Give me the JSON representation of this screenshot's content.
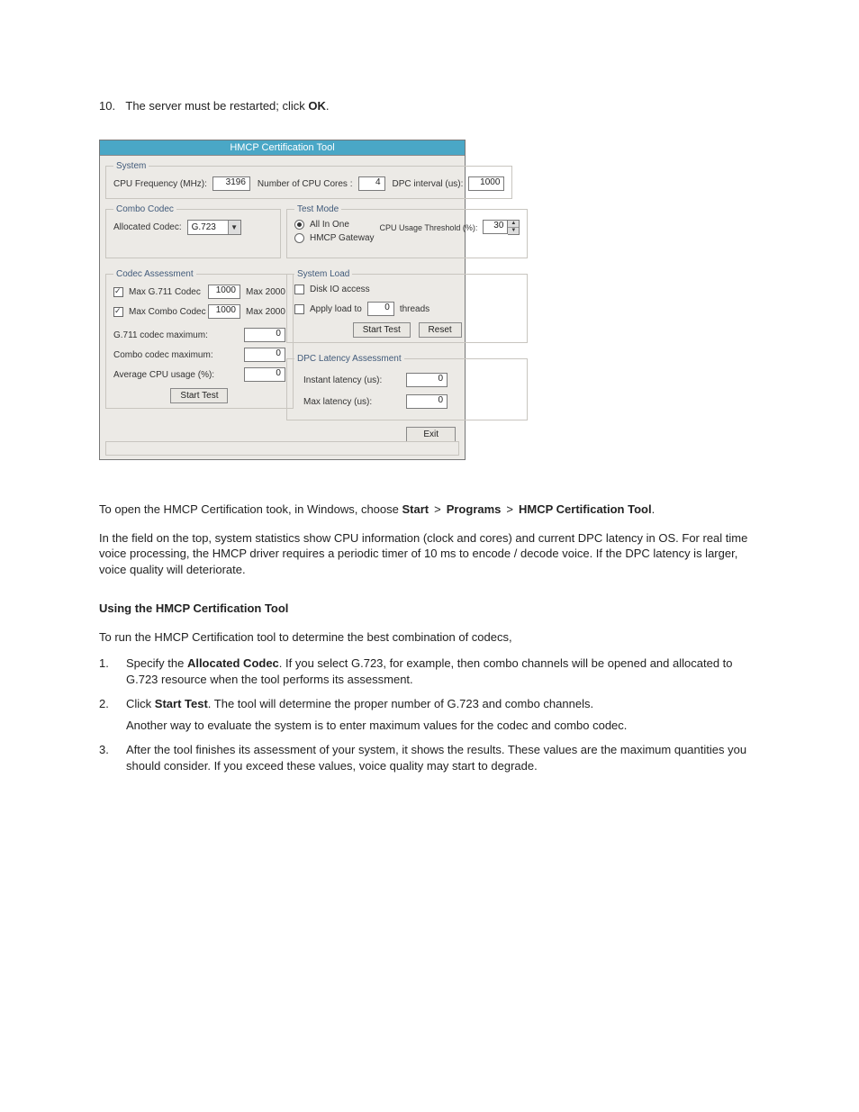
{
  "step10": {
    "num": "10.",
    "pre": "The server must be restarted; click ",
    "bold": "OK",
    "post": "."
  },
  "win": {
    "title": "HMCP Certification Tool",
    "system": {
      "legend": "System",
      "cpu_freq_label": "CPU Frequency (MHz):",
      "cpu_freq_value": "3196",
      "cores_label": "Number of CPU Cores :",
      "cores_value": "4",
      "dpc_label": "DPC interval (us):",
      "dpc_value": "1000"
    },
    "combo_codec": {
      "legend": "Combo Codec",
      "alloc_label": "Allocated Codec:",
      "alloc_value": "G.723"
    },
    "test_mode": {
      "legend": "Test Mode",
      "opt1": "All In One",
      "opt2": "HMCP Gateway",
      "thresh_label": "CPU Usage Threshold (%):",
      "thresh_value": "30"
    },
    "codec_assess": {
      "legend": "Codec Assessment",
      "g711_label": "Max G.711 Codec",
      "g711_value": "1000",
      "g711_max": "Max 2000",
      "combo_label": "Max Combo Codec",
      "combo_value": "1000",
      "combo_max": "Max 2000",
      "g711_max_label": "G.711 codec maximum:",
      "g711_max_value": "0",
      "combo_max_label": "Combo codec maximum:",
      "combo_max_value": "0",
      "avg_cpu_label": "Average CPU usage (%):",
      "avg_cpu_value": "0",
      "start": "Start Test"
    },
    "sysload": {
      "legend": "System Load",
      "disk_io": "Disk IO access",
      "apply_label_pre": "Apply load to",
      "apply_value": "0",
      "apply_label_post": "threads",
      "start": "Start Test",
      "reset": "Reset"
    },
    "dpc_assess": {
      "legend": "DPC Latency Assessment",
      "instant_label": "Instant latency (us):",
      "instant_value": "0",
      "max_label": "Max latency (us):",
      "max_value": "0"
    },
    "exit": "Exit"
  },
  "body": {
    "open_line_pre": "To open the HMCP Certification took, in Windows, choose ",
    "open_b1": "Start",
    "gt": ">",
    "open_b2": "Programs",
    "open_b3": "HMCP Certification Tool",
    "open_post": ".",
    "para2": "In the field on the top, system statistics show CPU information (clock and cores) and current DPC latency in OS. For real time voice processing, the HMCP driver requires a periodic timer of 10 ms to encode / decode voice. If the DPC latency is larger, voice quality will deteriorate.",
    "heading": "Using the HMCP Certification Tool",
    "intro": "To run the HMCP Certification tool to determine the best combination of codecs,",
    "s1": {
      "n": "1.",
      "pre": "Specify the ",
      "b": "Allocated Codec",
      "post": ". If you select G.723, for example, then combo channels will be opened and allocated to G.723 resource when the tool performs its assessment."
    },
    "s2": {
      "n": "2.",
      "pre": "Click ",
      "b": "Start Test",
      "post": ". The tool will determine the proper number of G.723 and combo channels.",
      "sub": "Another way to evaluate the system is to enter maximum values for the codec and combo codec."
    },
    "s3": {
      "n": "3.",
      "text": "After the tool finishes its assessment of your system, it shows the results. These values are the maximum quantities you should consider. If you exceed these values, voice quality may start to degrade."
    }
  }
}
